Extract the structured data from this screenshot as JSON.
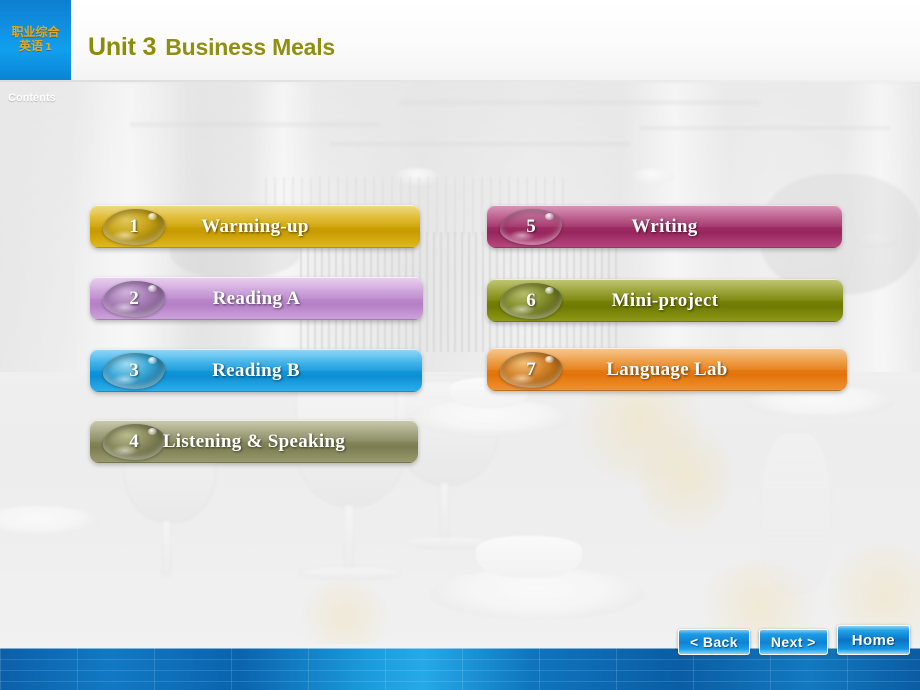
{
  "header": {
    "logo_line1": "职业综合",
    "logo_line2": "英语",
    "logo_number": "1",
    "title_unit": "Unit 3",
    "title_rest": "Business Meals",
    "title_color": "#8c8c08",
    "logo_bg_color": "#10a0ee",
    "logo_text_color": "#e8a81d"
  },
  "sidebar": {
    "contents_label": "Contents"
  },
  "menu": {
    "left_column": [
      {
        "number": "1",
        "label": "Warming-up",
        "color": "#d4a500",
        "drop_color": "#b88c00"
      },
      {
        "number": "2",
        "label": "Reading A",
        "color": "#c48fd0",
        "drop_color": "#9c6aa8"
      },
      {
        "number": "3",
        "label": "Reading B",
        "color": "#1b9ee0",
        "drop_color": "#1a7fb4"
      },
      {
        "number": "4",
        "label": "Listening & Speaking",
        "color": "#8d8f62",
        "drop_color": "#6e7049"
      }
    ],
    "right_column": [
      {
        "number": "5",
        "label": "Writing",
        "color": "#a8336b",
        "drop_color": "#852653"
      },
      {
        "number": "6",
        "label": "Mini-project",
        "color": "#7e8b05",
        "drop_color": "#5f6a04"
      },
      {
        "number": "7",
        "label": "Language Lab",
        "color": "#e8811a",
        "drop_color": "#bd6510"
      }
    ]
  },
  "nav": {
    "back_label": "< Back",
    "next_label": "Next >",
    "home_label": "Home",
    "accent_color": "#0e82d4"
  },
  "footer": {
    "band_color": "#0b5fa8"
  }
}
